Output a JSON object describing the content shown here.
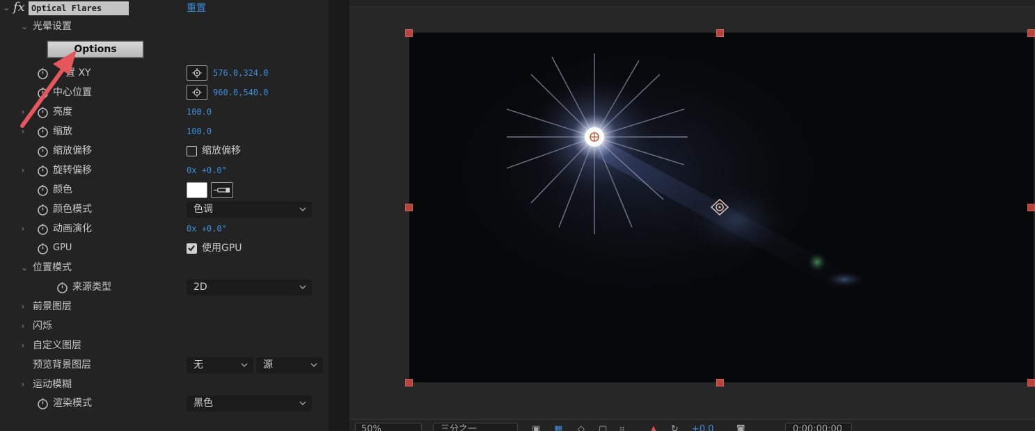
{
  "effect": {
    "name": "Optical Flares",
    "reset_label": "重置",
    "icon": "fx-icon"
  },
  "panel": {
    "rows": {
      "flare_setup": "光晕设置",
      "options_button": "Options",
      "position_xy_label": "置 XY",
      "position_xy_value": "576.0,324.0",
      "center_position_label": "中心位置",
      "center_position_value": "960.0,540.0",
      "brightness_label": "亮度",
      "brightness_value": "100.0",
      "scale_label": "缩放",
      "scale_value": "100.0",
      "scale_offset_label": "缩放偏移",
      "scale_offset_checkbox_label": "缩放偏移",
      "rotation_offset_label": "旋转偏移",
      "rotation_offset_turns": "0x",
      "rotation_offset_deg": "+0.0°",
      "color_label": "颜色",
      "color_value": "#ffffff",
      "color_mode_label": "颜色模式",
      "color_mode_value": "色调",
      "animation_evolution_label": "动画演化",
      "animation_evolution_turns": "0x",
      "animation_evolution_deg": "+0.0°",
      "gpu_label": "GPU",
      "gpu_checkbox_label": "使用GPU",
      "position_mode_label": "位置模式",
      "source_type_label": "来源类型",
      "source_type_value": "2D",
      "foreground_layers_label": "前景图层",
      "flicker_label": "闪烁",
      "custom_layers_label": "自定义图层",
      "preview_bg_label": "预览背景图层",
      "preview_bg_value": "无",
      "preview_bg_source": "源",
      "motion_blur_label": "运动模糊",
      "render_mode_label": "渲染模式",
      "render_mode_value": "黑色"
    }
  },
  "toolbar": {
    "zoom": "50%",
    "resolution": "三分之一",
    "exposure": "+0.0",
    "timecode": "0:00:00:00"
  },
  "colors": {
    "accent_blue": "#3e8edb",
    "handle_red": "#b5443d",
    "annotation_arrow": "#e5575c"
  }
}
